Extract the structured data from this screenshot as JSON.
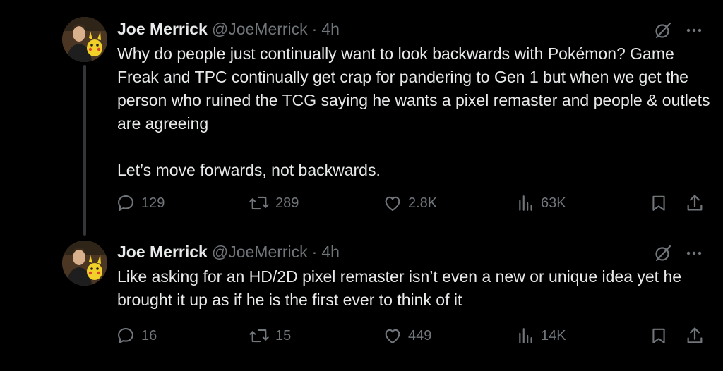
{
  "tweets": [
    {
      "author_name": "Joe Merrick",
      "handle": "@JoeMerrick",
      "separator": "·",
      "time": "4h",
      "text": "Why do people just continually want to look backwards with Pokémon? Game Freak and TPC continually get crap for pandering to Gen 1 but when we get the person who ruined the TCG saying he wants a pixel remaster and people & outlets are agreeing\n\nLet’s move forwards, not backwards.",
      "replies": "129",
      "reposts": "289",
      "likes": "2.8K",
      "views": "63K"
    },
    {
      "author_name": "Joe Merrick",
      "handle": "@JoeMerrick",
      "separator": "·",
      "time": "4h",
      "text": "Like asking for an HD/2D pixel remaster isn’t even a new or unique idea yet he brought it up as if he is the first ever to think of it",
      "replies": "16",
      "reposts": "15",
      "likes": "449",
      "views": "14K"
    }
  ],
  "colors": {
    "background": "#000000",
    "text": "#e7e9ea",
    "secondary": "#71767b",
    "thread_line": "#333639"
  },
  "icons": [
    "grok-icon",
    "more-icon",
    "reply-icon",
    "repost-icon",
    "like-icon",
    "views-icon",
    "bookmark-icon",
    "share-icon"
  ]
}
